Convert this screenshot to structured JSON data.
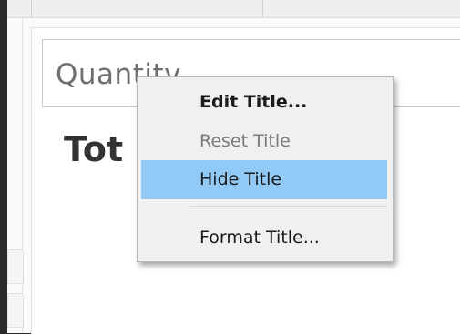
{
  "title_field": {
    "value": "Quantity"
  },
  "sheet": {
    "title_partial": "Tot"
  },
  "context_menu": {
    "items": [
      {
        "label": "Edit Title...",
        "style": "bold",
        "enabled": true,
        "highlighted": false
      },
      {
        "label": "Reset Title",
        "style": "normal",
        "enabled": false,
        "highlighted": false
      },
      {
        "label": "Hide Title",
        "style": "normal",
        "enabled": true,
        "highlighted": true
      },
      {
        "label": "Format Title...",
        "style": "normal",
        "enabled": true,
        "highlighted": false
      }
    ]
  },
  "colors": {
    "highlight": "#91c9f7",
    "menu_background": "#f0f0f0",
    "window_frame": "#2b2b2b"
  }
}
